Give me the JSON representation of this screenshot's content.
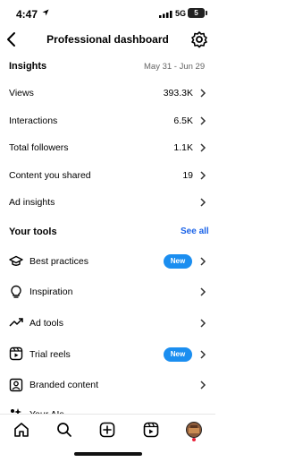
{
  "status": {
    "time": "4:47",
    "network": "5G",
    "battery": "5"
  },
  "header": {
    "title": "Professional dashboard"
  },
  "insights": {
    "title": "Insights",
    "date_range": "May 31 - Jun 29",
    "rows": [
      {
        "label": "Views",
        "value": "393.3K"
      },
      {
        "label": "Interactions",
        "value": "6.5K"
      },
      {
        "label": "Total followers",
        "value": "1.1K"
      },
      {
        "label": "Content you shared",
        "value": "19"
      },
      {
        "label": "Ad insights",
        "value": ""
      }
    ]
  },
  "tools": {
    "title": "Your tools",
    "see_all": "See all",
    "items": [
      {
        "label": "Best practices",
        "badge": "New",
        "icon": "graduation-cap-icon"
      },
      {
        "label": "Inspiration",
        "badge": "",
        "icon": "lightbulb-icon"
      },
      {
        "label": "Ad tools",
        "badge": "",
        "icon": "trending-up-icon"
      },
      {
        "label": "Trial reels",
        "badge": "New",
        "icon": "reels-icon"
      },
      {
        "label": "Branded content",
        "badge": "",
        "icon": "person-badge-icon"
      },
      {
        "label": "Your AIs",
        "badge": "",
        "icon": "ai-icon"
      }
    ]
  },
  "tabbar": {
    "items": [
      "home-icon",
      "search-icon",
      "create-icon",
      "reels-icon",
      "profile-avatar"
    ]
  },
  "colors": {
    "accent": "#1a63e8",
    "badge": "#1b8ef0",
    "notification": "#e8243b"
  }
}
